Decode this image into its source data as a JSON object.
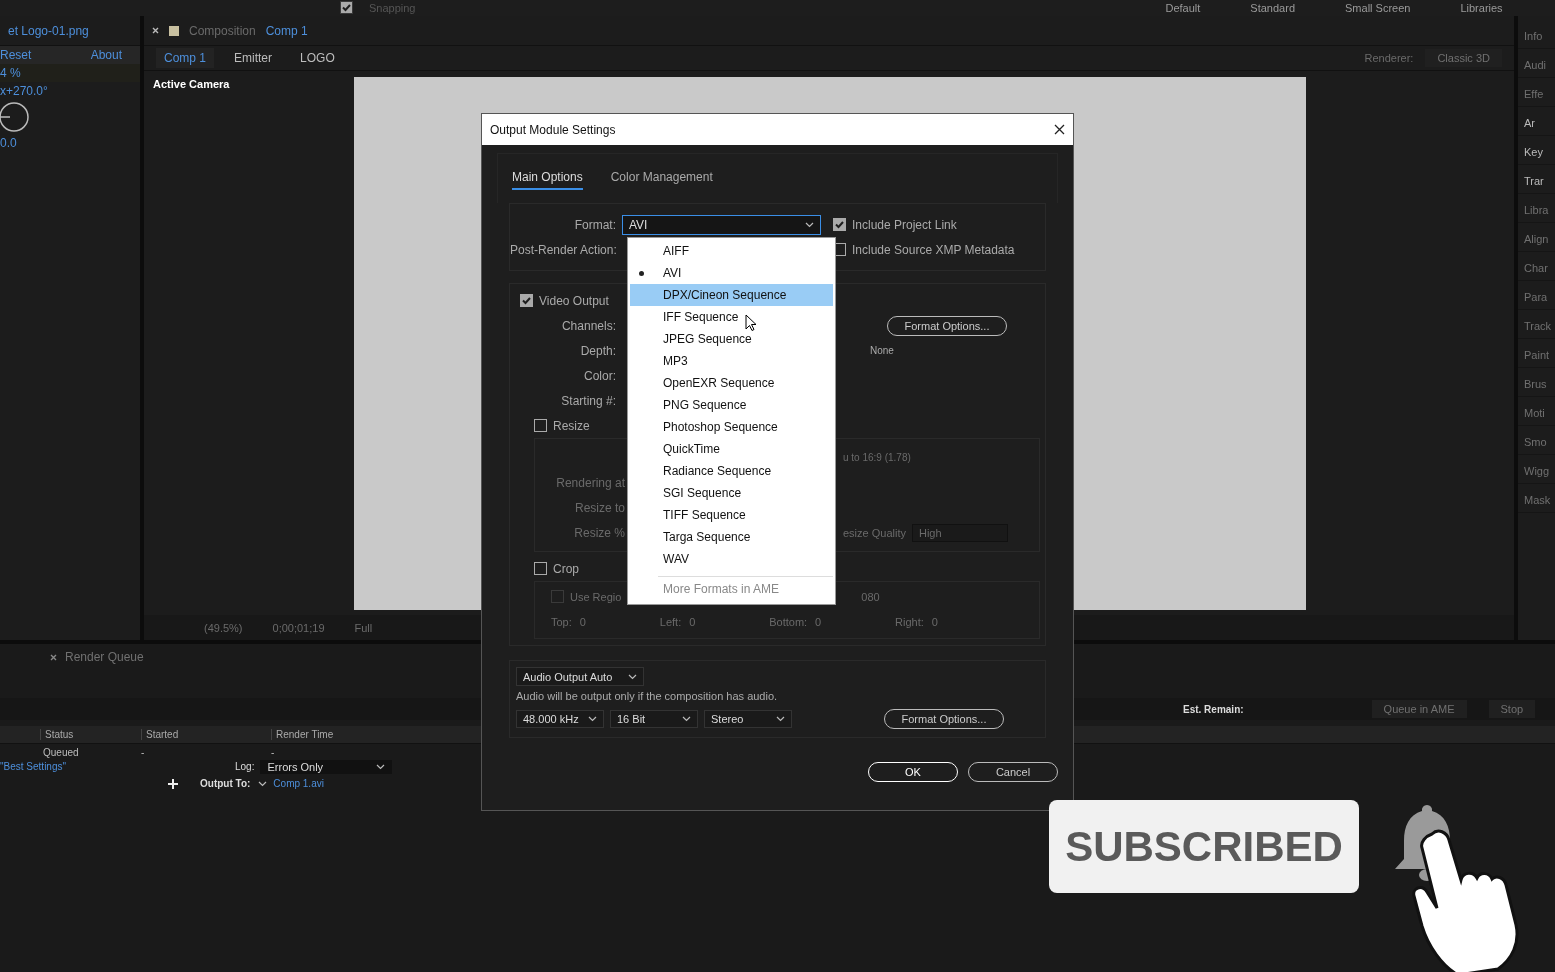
{
  "toolbar": {
    "snapping": {
      "label": "Snapping",
      "checked": true
    },
    "workspaces": [
      "Default",
      "Standard",
      "Small Screen",
      "Libraries"
    ]
  },
  "effect_panel": {
    "tab": "et Logo-01.png",
    "reset": "Reset",
    "about": "About",
    "values": [
      "4 %",
      "x+270.0°",
      "0.0"
    ]
  },
  "composition": {
    "tab_prefix": "Composition",
    "tab_name": "Comp 1",
    "breadcrumbs": [
      {
        "label": "Comp 1",
        "selected": true
      },
      {
        "label": "Emitter",
        "selected": false
      },
      {
        "label": "LOGO",
        "selected": false
      }
    ],
    "renderer_label": "Renderer:",
    "renderer": "Classic 3D",
    "view_label": "Active Camera",
    "footer": {
      "zoom": "(49.5%)",
      "timecode": "0;00;01;19",
      "resolution": "Full"
    }
  },
  "right_panels": {
    "top": [
      "Info",
      "Audi",
      "Effe"
    ],
    "tree": [
      "Ar",
      "Key",
      "Trar"
    ],
    "lower": [
      "Libra",
      "Align",
      "Char",
      "Para",
      "Track",
      "Paint",
      "Brus",
      "Moti",
      "Smo",
      "Wigg",
      "Mask"
    ]
  },
  "render_queue": {
    "tab": "Render Queue",
    "est_remain": "Est. Remain:",
    "buttons": [
      "Queue in AME",
      "Stop"
    ],
    "columns": [
      "Status",
      "Started",
      "Render Time"
    ],
    "row": {
      "status": "Queued",
      "started": "-",
      "render_time": "-"
    },
    "settings": "\"Best Settings\"",
    "log_label": "Log:",
    "log": "Errors Only",
    "output_label": "Output To:",
    "output": "Comp 1.avi"
  },
  "dialog": {
    "title": "Output Module Settings",
    "tabs": [
      {
        "label": "Main Options",
        "selected": true
      },
      {
        "label": "Color Management",
        "selected": false
      }
    ],
    "format_label": "Format:",
    "format": "AVI",
    "post_render_label": "Post-Render Action:",
    "options": [
      {
        "label": "Include Project Link",
        "checked": true
      },
      {
        "label": "Include Source XMP Metadata",
        "checked": false
      }
    ],
    "video": {
      "label": "Video Output",
      "checked": true,
      "fields": [
        "Channels:",
        "Depth:",
        "Color:",
        "Starting #:"
      ],
      "format_options": "Format Options...",
      "compression": "None"
    },
    "resize": {
      "label": "Resize",
      "checked": false,
      "fields": [
        "Rendering at",
        "Resize to",
        "Resize %"
      ],
      "aspect": "u to 16:9 (1.78)",
      "quality_label": "esize Quality",
      "quality": "High"
    },
    "crop": {
      "label": "Crop",
      "checked": false,
      "region_label": "Use Regio",
      "region_checked": false,
      "region_value": "080",
      "sides": [
        {
          "label": "Top:",
          "value": "0"
        },
        {
          "label": "Left:",
          "value": "0"
        },
        {
          "label": "Bottom:",
          "value": "0"
        },
        {
          "label": "Right:",
          "value": "0"
        }
      ]
    },
    "audio": {
      "mode": "Audio Output Auto",
      "note": "Audio will be output only if the composition has audio.",
      "rate": "48.000 kHz",
      "bits": "16 Bit",
      "channels": "Stereo",
      "format_options": "Format Options..."
    },
    "buttons": [
      "OK",
      "Cancel"
    ]
  },
  "format_menu": [
    {
      "label": "AIFF",
      "selected": false,
      "highlighted": false,
      "disabled": false
    },
    {
      "label": "AVI",
      "selected": true,
      "highlighted": false,
      "disabled": false
    },
    {
      "label": "DPX/Cineon Sequence",
      "selected": false,
      "highlighted": true,
      "disabled": false
    },
    {
      "label": "IFF Sequence",
      "selected": false,
      "highlighted": false,
      "disabled": false
    },
    {
      "label": "JPEG Sequence",
      "selected": false,
      "highlighted": false,
      "disabled": false
    },
    {
      "label": "MP3",
      "selected": false,
      "highlighted": false,
      "disabled": false
    },
    {
      "label": "OpenEXR Sequence",
      "selected": false,
      "highlighted": false,
      "disabled": false
    },
    {
      "label": "PNG Sequence",
      "selected": false,
      "highlighted": false,
      "disabled": false
    },
    {
      "label": "Photoshop Sequence",
      "selected": false,
      "highlighted": false,
      "disabled": false
    },
    {
      "label": "QuickTime",
      "selected": false,
      "highlighted": false,
      "disabled": false
    },
    {
      "label": "Radiance Sequence",
      "selected": false,
      "highlighted": false,
      "disabled": false
    },
    {
      "label": "SGI Sequence",
      "selected": false,
      "highlighted": false,
      "disabled": false
    },
    {
      "label": "TIFF Sequence",
      "selected": false,
      "highlighted": false,
      "disabled": false
    },
    {
      "label": "Targa Sequence",
      "selected": false,
      "highlighted": false,
      "disabled": false
    },
    {
      "label": "WAV",
      "selected": false,
      "highlighted": false,
      "disabled": false
    },
    {
      "label": "More Formats in AME",
      "selected": false,
      "highlighted": false,
      "disabled": true
    }
  ],
  "subscribe_overlay": {
    "label": "SUBSCRIBED"
  }
}
